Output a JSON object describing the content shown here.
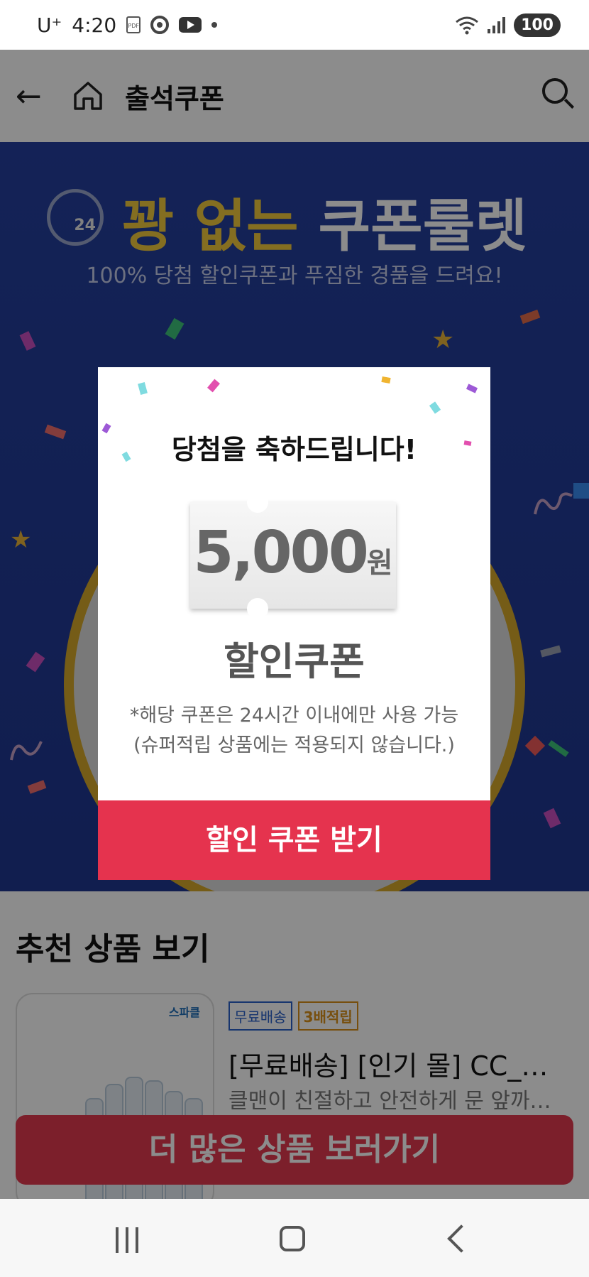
{
  "status_bar": {
    "carrier": "U⁺",
    "time": "4:20",
    "battery": "100"
  },
  "header": {
    "title": "출석쿠폰"
  },
  "banner": {
    "clock_label": "24",
    "headline_gold": "꽝 없는",
    "headline_white": "쿠폰룰렛",
    "subhead": "100% 당첨 할인쿠폰과 푸짐한 경품을 드려요!"
  },
  "recommend": {
    "section_title": "추천 상품 보기",
    "product": {
      "brand_logo": "스파클",
      "tags": [
        "무료배송",
        "3배적립"
      ],
      "title": "[무료배송] [인기 몰] CC_…",
      "desc": "클맨이 친절하고 안전하게 문 앞까…"
    },
    "more_button": "더 많은 상품 보러가기"
  },
  "modal": {
    "congrats": "당첨을 축하드립니다!",
    "amount": "5,000",
    "unit": "원",
    "coupon_label": "할인쿠폰",
    "notice_line1": "*해당 쿠폰은 24시간 이내에만 사용 가능",
    "notice_line2": "(슈퍼적립 상품에는 적용되지 않습니다.)",
    "receive_button": "할인 쿠폰 받기"
  },
  "colors": {
    "banner_blue": "#253f9e",
    "headline_gold": "#f0c83c",
    "accent_red": "#e5334e"
  },
  "icons": [
    "back-arrow-icon",
    "home-icon",
    "search-icon",
    "recents-icon",
    "home-nav-icon",
    "back-nav-icon"
  ]
}
